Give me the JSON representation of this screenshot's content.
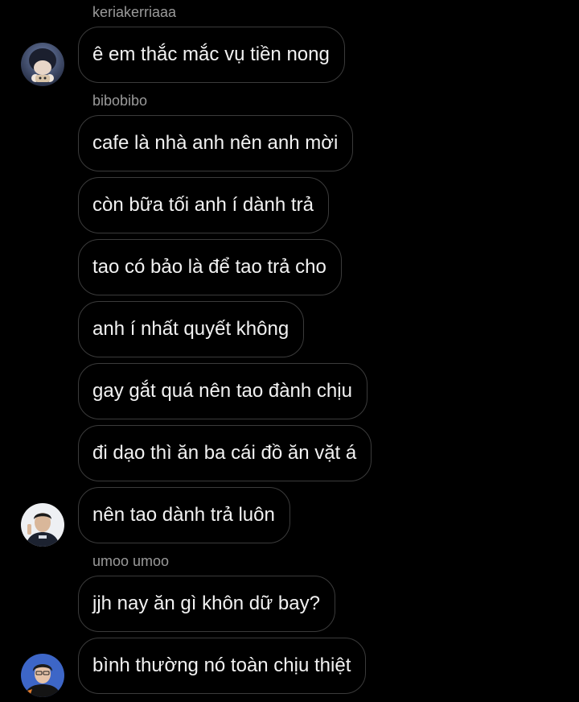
{
  "conversation": {
    "groups": [
      {
        "sender": "keriakerriaaa",
        "messages": [
          "ê em thắc mắc vụ tiền nong"
        ],
        "avatar_icon": "user-avatar-icon"
      },
      {
        "sender": "bibobibo",
        "messages": [
          "cafe là nhà anh nên anh mời",
          "còn bữa tối anh í dành trả",
          "tao có bảo là để tao trả cho",
          "anh í nhất quyết không",
          "gay gắt quá nên tao đành chịu",
          "đi dạo thì ăn ba cái đồ ăn vặt á",
          "nên tao dành trả luôn"
        ],
        "avatar_icon": "user-avatar-icon"
      },
      {
        "sender": "umoo umoo",
        "messages": [
          "jjh nay ăn gì khôn dữ bay?",
          "bình thường nó toàn chịu thiệt"
        ],
        "avatar_icon": "user-avatar-icon"
      }
    ]
  },
  "colors": {
    "background": "#000000",
    "bubble_border": "#3b3b3b",
    "message_text": "#f2f2f2",
    "sender_text": "#9a9a9a"
  }
}
